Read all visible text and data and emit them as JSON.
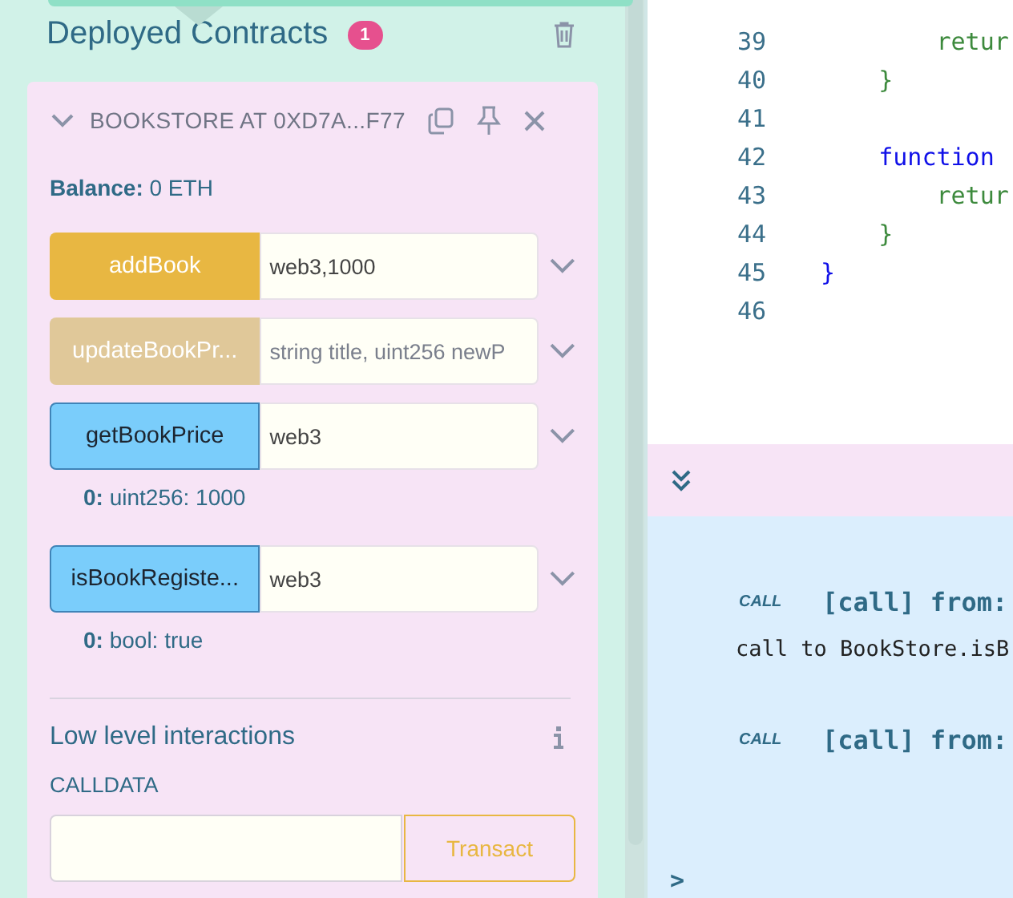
{
  "deployed": {
    "title": "Deployed Contracts",
    "count": "1"
  },
  "contract": {
    "name": "BOOKSTORE AT 0XD7A...F77",
    "expanded": true,
    "balance": "**Balance:** 0 ETH",
    "functions": [
      {
        "kind": "transact",
        "label": "addBook",
        "value": "web3,1000"
      },
      {
        "kind": "faded",
        "label": "updateBookPr...",
        "placeholder": "string title, uint256 newP"
      },
      {
        "kind": "call",
        "label": "getBookPrice",
        "value": "web3",
        "result": "**0:** uint256: 1000"
      },
      {
        "kind": "call",
        "label": "isBookRegiste...",
        "value": "web3",
        "result": "**0:** bool: true"
      }
    ],
    "low_level": {
      "title": "Low level interactions",
      "calldata_label": "CALLDATA",
      "button": "Transact"
    }
  },
  "editor": {
    "lines": [
      {
        "number": "39",
        "kind": "body",
        "code": "        retur"
      },
      {
        "number": "40",
        "kind": "body",
        "code": "    }"
      },
      {
        "number": "41"
      },
      {
        "number": "42",
        "kind": "keyword",
        "code": "    function"
      },
      {
        "number": "43",
        "kind": "body",
        "code": "        retur"
      },
      {
        "number": "44",
        "kind": "body",
        "code": "    }"
      },
      {
        "number": "45",
        "kind": "keyword",
        "code": "}"
      },
      {
        "number": "46"
      }
    ]
  },
  "terminal": {
    "entries": [
      {
        "tag": "CALL",
        "head": "[call] from:",
        "detail": "call to BookStore.isB"
      },
      {
        "tag": "CALL",
        "head": "[call] from:"
      }
    ],
    "prompt": ">"
  }
}
